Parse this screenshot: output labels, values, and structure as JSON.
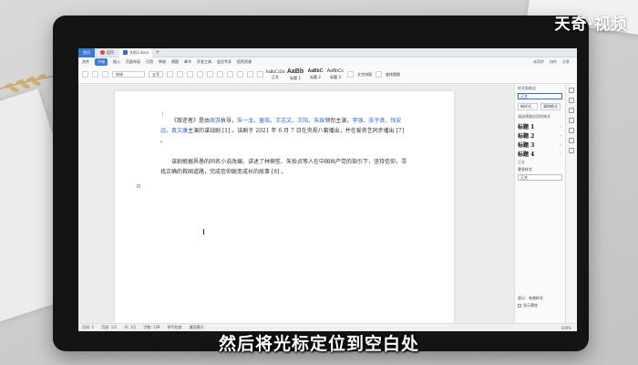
{
  "watermark": "天奇·视频",
  "subtitle": "然后将光标定位到空白处",
  "tabbar": {
    "home": "首页",
    "tabs": [
      "稻壳",
      "文档1.docx"
    ],
    "add": "+"
  },
  "menubar": {
    "items": [
      "文件",
      "开始",
      "插入",
      "页面布局",
      "引用",
      "审阅",
      "视图",
      "章节",
      "开发工具",
      "会员专享",
      "稻壳资源"
    ],
    "active_index": 1,
    "right": [
      "未同步",
      "协作",
      "分享"
    ]
  },
  "toolbar": {
    "font_name": "宋体",
    "font_size": "五号",
    "styles": [
      {
        "preview": "AaBbCcDd",
        "label": "正文"
      },
      {
        "preview": "AaBb",
        "label": "标题 1"
      },
      {
        "preview": "AaBbC",
        "label": "标题 2"
      },
      {
        "preview": "AaBbCc",
        "label": "标题 3"
      }
    ],
    "find_label": "文字排版",
    "replace_label": "查找替换"
  },
  "document": {
    "para1": [
      {
        "t": "《叛逆者》是由",
        "link": false
      },
      {
        "t": "周游",
        "link": true
      },
      {
        "t": "执导，",
        "link": false
      },
      {
        "t": "朱一龙",
        "link": true
      },
      {
        "t": "、",
        "link": false
      },
      {
        "t": "童瑶",
        "link": true
      },
      {
        "t": "、",
        "link": false
      },
      {
        "t": "王志文",
        "link": true
      },
      {
        "t": "、",
        "link": false
      },
      {
        "t": "王阳",
        "link": true
      },
      {
        "t": "、",
        "link": false
      },
      {
        "t": "朱珠",
        "link": true
      },
      {
        "t": "领衔主演，",
        "link": false
      },
      {
        "t": "李强",
        "link": true
      },
      {
        "t": "、",
        "link": false
      },
      {
        "t": "张子贤",
        "link": true
      },
      {
        "t": "、",
        "link": false
      },
      {
        "t": "钱安远",
        "link": true
      },
      {
        "t": "、",
        "link": false
      },
      {
        "t": "袁文康",
        "link": true
      },
      {
        "t": "主演的谍战剧 [1] 。该剧于 2021 年 6 月 7 日在央视八套播出，并在爱奇艺同步播出 [7] 。",
        "link": false
      }
    ],
    "para2": "该剧根据畀愚的同名小说改编，讲述了林楠笙、朱怡贞等人在中国共产党的指引下，坚持信仰，寻找正确的救国道路，完成信仰蜕变成长的故事 [8] 。"
  },
  "panel": {
    "title": "样式和格式",
    "current": "正文",
    "btn_new": "新样式...",
    "btn_clear": "清除格式",
    "sub": "请选择要应用的格式",
    "headings": [
      "标题 1",
      "标题 2",
      "标题 3",
      "标题 4"
    ],
    "body_style": "正文",
    "link_more": "更多样式",
    "current_style_label": "显示：有效样式",
    "bottom_current": "正文",
    "preview_label": "显示预览"
  },
  "statusbar": {
    "page": "页码: 1",
    "pages": "页面: 1/1",
    "section": "节: 1/1",
    "words": "字数: 139",
    "spell": "拼写检查",
    "compat": "兼容模式",
    "zoom": "100%"
  }
}
